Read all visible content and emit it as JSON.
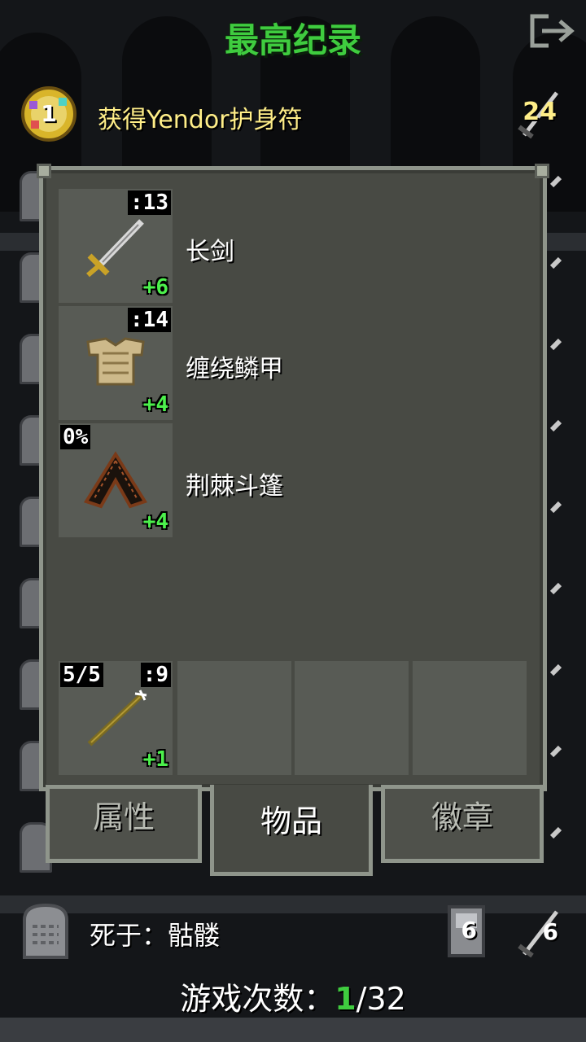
{
  "header": {
    "title": "最高纪录"
  },
  "record": {
    "rank": "1",
    "description": "获得Yendor护身符",
    "depth": "24"
  },
  "items": [
    {
      "name": "长剑",
      "top_right": ":13",
      "level": "+6",
      "icon": "longsword-icon"
    },
    {
      "name": "缠绕鳞甲",
      "top_right": ":14",
      "level": "+4",
      "icon": "scale-armor-icon"
    },
    {
      "name": "荆棘斗篷",
      "top_left": "0%",
      "level": "+4",
      "icon": "thorn-cloak-icon"
    }
  ],
  "quickslot": {
    "charges": "5/5",
    "top_right": ":9",
    "level": "+1",
    "icon": "wand-icon"
  },
  "tabs": [
    {
      "label": "属性",
      "active": false
    },
    {
      "label": "物品",
      "active": true
    },
    {
      "label": "徽章",
      "active": false
    }
  ],
  "footer": {
    "death_cause": "死于：骷髅",
    "level": "6",
    "depth": "6"
  },
  "games": {
    "label": "游戏次数：",
    "current": "1",
    "total": "/32"
  },
  "colors": {
    "title_green": "#3fcc3f",
    "upgrade_green": "#4cf04c",
    "record_yellow": "#ffee88",
    "panel": "#484a44"
  }
}
